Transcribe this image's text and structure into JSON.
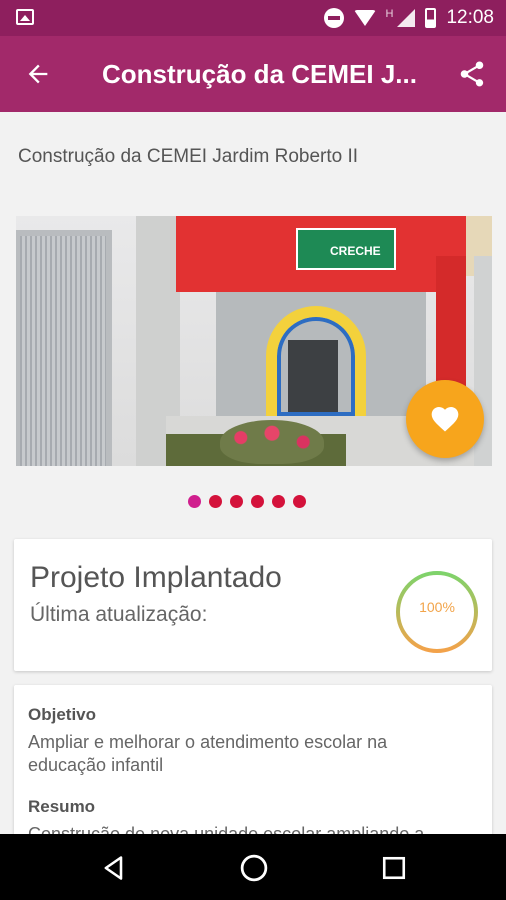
{
  "status_bar": {
    "time": "12:08",
    "network_label": "H"
  },
  "app_bar": {
    "title": "Construção da CEMEI J...",
    "back_icon": "arrow-left-icon",
    "share_icon": "share-icon",
    "color": "#a2296a"
  },
  "page": {
    "title": "Construção da CEMEI Jardim Roberto II"
  },
  "gallery": {
    "sign_text": "CRECHE",
    "dots_count": 6,
    "active_index": 0
  },
  "favorite": {
    "icon": "heart-icon",
    "color": "#f7a51c"
  },
  "status_card": {
    "title": "Projeto Implantado",
    "updated_label": "Última atualização:",
    "progress_text": "100%",
    "progress_value": 1.0
  },
  "info_card": {
    "objective_label": "Objetivo",
    "objective_text": "Ampliar e melhorar o atendimento escolar na educação infantil",
    "summary_label": "Resumo",
    "summary_text": "Construção de nova unidade escolar ampliando a"
  },
  "nav_bar": {
    "back_icon": "nav-back-icon",
    "home_icon": "nav-home-icon",
    "recents_icon": "nav-recents-icon"
  }
}
